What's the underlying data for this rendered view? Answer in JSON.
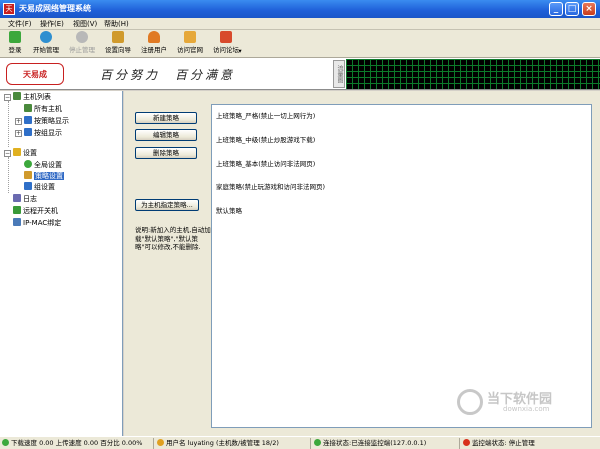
{
  "window": {
    "title": "天易成网络管理系统",
    "icon_char": "天",
    "minimize": "_",
    "maximize": "□",
    "close": "×"
  },
  "menu": [
    {
      "label": "文件(F)"
    },
    {
      "label": "操作(E)"
    },
    {
      "label": "视图(V)"
    },
    {
      "label": "帮助(H)"
    }
  ],
  "toolbar": [
    {
      "label": "登录",
      "icon": "login-icon",
      "color": "#3ca83c"
    },
    {
      "label": "开始管理",
      "icon": "start-icon",
      "color": "#2f8fd0"
    },
    {
      "label": "停止管理",
      "icon": "stop-icon",
      "color": "#9a9a9a"
    },
    {
      "label": "设置向导",
      "icon": "wizard-icon",
      "color": "#d09a2c"
    },
    {
      "label": "注册用户",
      "icon": "register-user-icon",
      "color": "#e07a24"
    },
    {
      "label": "访问官网",
      "icon": "home-icon",
      "color": "#e6a83a"
    },
    {
      "label": "访问论坛",
      "icon": "forum-icon",
      "color": "#d84a2c"
    },
    {
      "label": "▾"
    }
  ],
  "banner": {
    "logo": "天易成",
    "slogan": "百分努力　百分满意",
    "graph_label": "流量图"
  },
  "sidebar": {
    "items": [
      {
        "label": "主机列表"
      },
      {
        "label": "所有主机"
      },
      {
        "label": "按策略显示"
      },
      {
        "label": "按组显示"
      },
      {
        "label": "设置"
      },
      {
        "label": "全局设置"
      },
      {
        "label": "策略设置"
      },
      {
        "label": "组设置"
      },
      {
        "label": "日志"
      },
      {
        "label": "远程开关机"
      },
      {
        "label": "IP-MAC绑定"
      }
    ]
  },
  "buttons": {
    "new_policy": "新建策略",
    "edit_policy": "编辑策略",
    "delete_policy": "删除策略",
    "assign_policy": "为主机指定策略..."
  },
  "note": "说明:新加入的主机,自动加载\"默认策略\",\"默认策略\"可以修改,不能删除.",
  "policies": [
    "上班策略_严格(禁止一切上网行为)",
    "上班策略_中级(禁止炒股游戏下载)",
    "上班策略_基本(禁止访问非法网页)",
    "家庭策略(禁止玩游戏和访问非法网页)",
    "默认策略"
  ],
  "watermark": {
    "text": "当下软件园",
    "sub": "downxia.com"
  },
  "status": {
    "speed": "下载速度 0.00 上传速度 0.00 百分比 0.00%",
    "user": "用户名 luyating (主机数/被管理 18/2)",
    "connection": "连接状态:已连接监控端(127.0.0.1)",
    "monitor": "监控端状态: 停止管理"
  },
  "colors": {
    "title_bar": "#1e5fd8",
    "selection": "#316ac5",
    "graph_grid": "#0c7a2a"
  }
}
